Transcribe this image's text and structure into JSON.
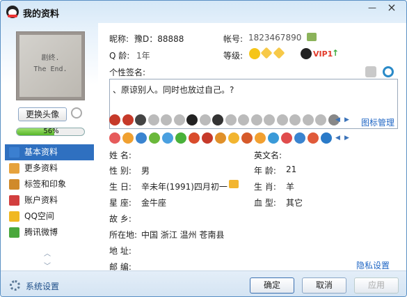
{
  "window": {
    "title": "我的资料",
    "minimize": "—",
    "close": "×"
  },
  "avatar": {
    "text_line1": "剧终.",
    "text_line2": "The End."
  },
  "change_avatar_label": "更换头像",
  "profile_progress": {
    "label": "56%",
    "value": 0.56
  },
  "nav": [
    {
      "label": "基本资料",
      "active": true,
      "icon": "id-card-icon",
      "color": "#3b7fd0"
    },
    {
      "label": "更多资料",
      "active": false,
      "icon": "doc-icon",
      "color": "#e6a23c"
    },
    {
      "label": "标签和印象",
      "active": false,
      "icon": "tag-icon",
      "color": "#d08a2a"
    },
    {
      "label": "账户资料",
      "active": false,
      "icon": "account-icon",
      "color": "#d23f3f"
    },
    {
      "label": "QQ空间",
      "active": false,
      "icon": "star-icon",
      "color": "#f0b822"
    },
    {
      "label": "腾讯微博",
      "active": false,
      "icon": "weibo-icon",
      "color": "#4aa83c"
    }
  ],
  "header": {
    "nickname_label": "昵称:",
    "nickname_value": "豫D：88888",
    "account_label": "帐号:",
    "account_value": "1823467890",
    "age_label": "Q 龄:",
    "age_value": "1年",
    "level_label": "等级:",
    "vip_label": "VIP1"
  },
  "signature": {
    "label": "个性签名:",
    "text": "、原谅别人。同时也放过自己。?"
  },
  "icon_manage_label": "图标管理",
  "profile": {
    "name_label": "姓    名:",
    "name_value": "",
    "english_name_label": "英文名:",
    "english_name_value": "",
    "gender_label": "性    别:",
    "gender_value": "男",
    "age_label": "年    龄:",
    "age_value": "21",
    "birthday_label": "生    日:",
    "birthday_value": "辛未年(1991)四月初一",
    "zodiac_label": "生    肖:",
    "zodiac_value": "羊",
    "constellation_label": "星    座:",
    "constellation_value": "金牛座",
    "blood_label": "血    型:",
    "blood_value": "其它",
    "hometown_label": "故    乡:",
    "hometown_value": "",
    "location_label": "所在地:",
    "location_value": "中国  浙江  温州  苍南县",
    "address_label": "地    址:",
    "address_value": "",
    "postcode_label": "邮    编:",
    "postcode_value": ""
  },
  "privacy_label": "隐私设置",
  "footer": {
    "settings_label": "系统设置",
    "ok_label": "确定",
    "cancel_label": "取消",
    "apply_label": "应用"
  }
}
